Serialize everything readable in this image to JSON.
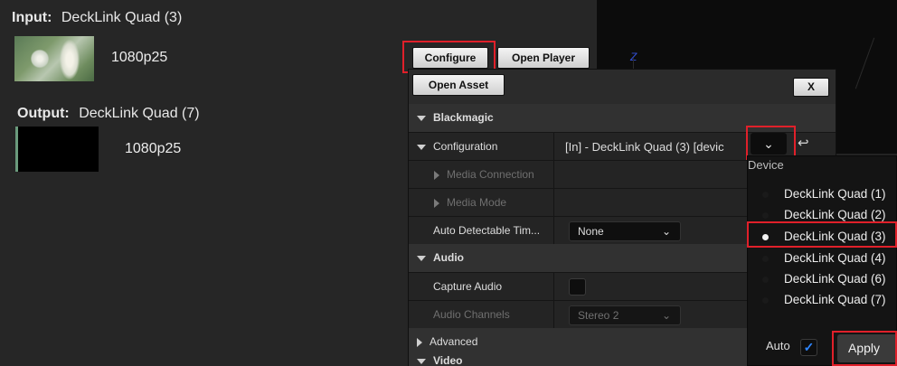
{
  "left": {
    "input_label": "Input:",
    "input_device": "DeckLink Quad (3)",
    "input_res": "1080p25",
    "output_label": "Output:",
    "output_device": "DeckLink Quad (7)",
    "output_res": "1080p25"
  },
  "viewport": {
    "axis_label": "Z"
  },
  "toolbar": {
    "configure": "Configure",
    "open_player": "Open Player",
    "open_asset": "Open Asset",
    "close": "X"
  },
  "details": {
    "blackmagic": "Blackmagic",
    "configuration": "Configuration",
    "configuration_value": "[In] - DeckLink Quad (3) [devic",
    "media_connection": "Media Connection",
    "media_mode": "Media Mode",
    "auto_detect": "Auto Detectable Tim...",
    "auto_detect_value": "None",
    "audio": "Audio",
    "capture_audio": "Capture Audio",
    "audio_channels": "Audio Channels",
    "audio_channels_value": "Stereo 2",
    "advanced": "Advanced",
    "video": "Video"
  },
  "dropdown": {
    "header": "Device",
    "items": [
      {
        "label": "DeckLink Quad (1)",
        "selected": false
      },
      {
        "label": "DeckLink Quad (2)",
        "selected": false
      },
      {
        "label": "DeckLink Quad (3)",
        "selected": true
      },
      {
        "label": "DeckLink Quad (4)",
        "selected": false
      },
      {
        "label": "DeckLink Quad (6)",
        "selected": false
      },
      {
        "label": "DeckLink Quad (7)",
        "selected": false
      }
    ],
    "auto_label": "Auto",
    "auto_checked": true,
    "apply": "Apply"
  },
  "icons": {
    "chevron": "chevron-down-icon",
    "reset": "reset-arrow-icon",
    "check": "checkmark-icon"
  },
  "colors": {
    "highlight": "#e0202a",
    "check_blue": "#2e86ff",
    "axis_blue": "#3350d8"
  }
}
